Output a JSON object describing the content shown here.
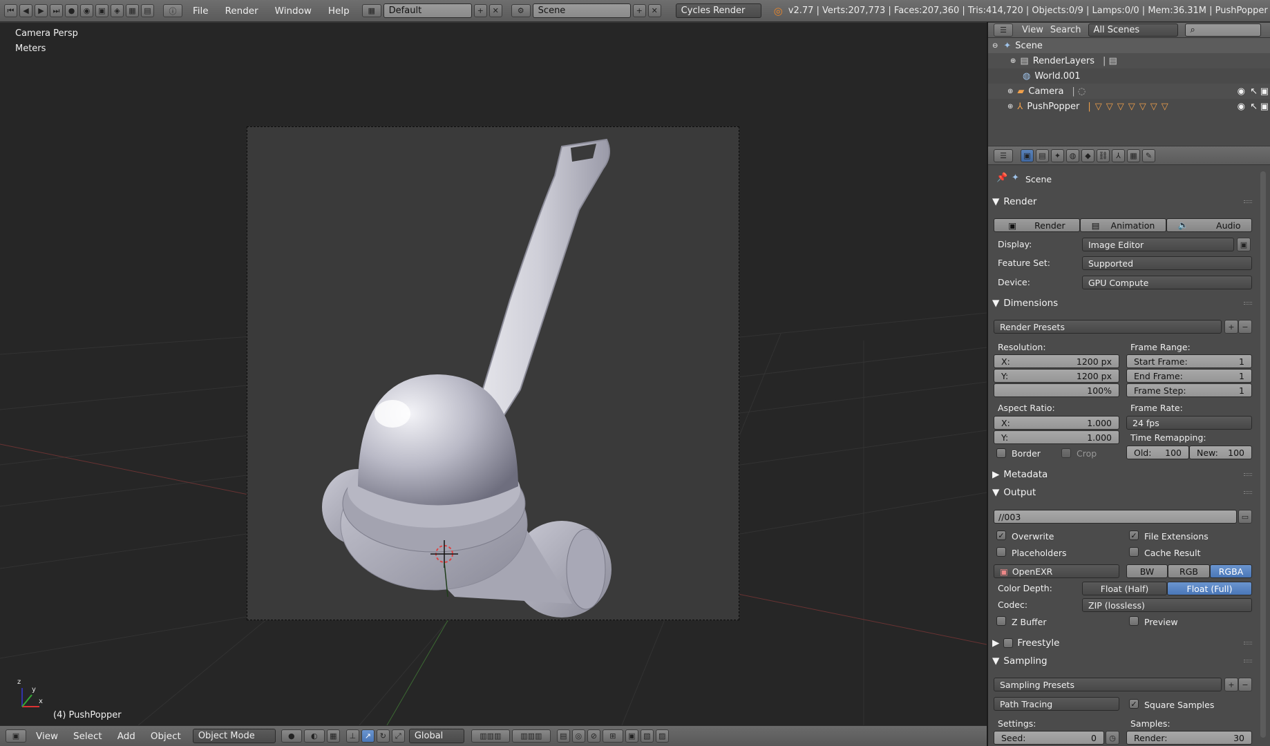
{
  "top_bar": {
    "menus": [
      "File",
      "Render",
      "Window",
      "Help"
    ],
    "screen_layout": "Default",
    "scene": "Scene",
    "render_engine": "Cycles Render",
    "stats": "v2.77 | Verts:207,773 | Faces:207,360 | Tris:414,720 | Objects:0/9 | Lamps:0/0 | Mem:36.31M | PushPopper"
  },
  "viewport": {
    "view_name": "Camera Persp",
    "units": "Meters",
    "object_label": "(4) PushPopper",
    "axis_x": "x",
    "axis_y": "y",
    "axis_z": "z"
  },
  "bottom_bar": {
    "menus": [
      "View",
      "Select",
      "Add",
      "Object"
    ],
    "mode": "Object Mode",
    "orientation": "Global"
  },
  "outliner": {
    "menus": [
      "View",
      "Search"
    ],
    "filter": "All Scenes",
    "items": [
      {
        "label": "Scene"
      },
      {
        "label": "RenderLayers"
      },
      {
        "label": "World.001"
      },
      {
        "label": "Camera"
      },
      {
        "label": "PushPopper"
      }
    ]
  },
  "properties": {
    "context": "Scene",
    "render_panel": {
      "title": "Render",
      "render_btn": "Render",
      "animation_btn": "Animation",
      "audio_btn": "Audio",
      "display_label": "Display:",
      "display_value": "Image Editor",
      "feature_label": "Feature Set:",
      "feature_value": "Supported",
      "device_label": "Device:",
      "device_value": "GPU Compute"
    },
    "dimensions": {
      "title": "Dimensions",
      "presets": "Render Presets",
      "resolution_label": "Resolution:",
      "res_x_label": "X:",
      "res_x": "1200 px",
      "res_y_label": "Y:",
      "res_y": "1200 px",
      "res_pct": "100%",
      "frame_range_label": "Frame Range:",
      "start_label": "Start Frame:",
      "start": "1",
      "end_label": "End Frame:",
      "end": "1",
      "step_label": "Frame Step:",
      "step": "1",
      "aspect_label": "Aspect Ratio:",
      "aspect_x_label": "X:",
      "aspect_x": "1.000",
      "aspect_y_label": "Y:",
      "aspect_y": "1.000",
      "frame_rate_label": "Frame Rate:",
      "frame_rate": "24 fps",
      "remap_label": "Time Remapping:",
      "old_label": "Old:",
      "old": "100",
      "new_label": "New:",
      "new": "100",
      "border_label": "Border",
      "crop_label": "Crop"
    },
    "metadata": {
      "title": "Metadata"
    },
    "output": {
      "title": "Output",
      "path": "//003",
      "overwrite": "Overwrite",
      "file_ext": "File Extensions",
      "placeholders": "Placeholders",
      "cache": "Cache Result",
      "format": "OpenEXR",
      "bw": "BW",
      "rgb": "RGB",
      "rgba": "RGBA",
      "color_depth_label": "Color Depth:",
      "half": "Float (Half)",
      "full": "Float (Full)",
      "codec_label": "Codec:",
      "codec": "ZIP (lossless)",
      "zbuffer": "Z Buffer",
      "preview": "Preview"
    },
    "freestyle": {
      "title": "Freestyle"
    },
    "sampling": {
      "title": "Sampling",
      "presets": "Sampling Presets",
      "method": "Path Tracing",
      "square": "Square Samples",
      "settings_label": "Settings:",
      "samples_label": "Samples:",
      "seed_label": "Seed:",
      "seed": "0",
      "render_label": "Render:",
      "render": "30"
    }
  }
}
